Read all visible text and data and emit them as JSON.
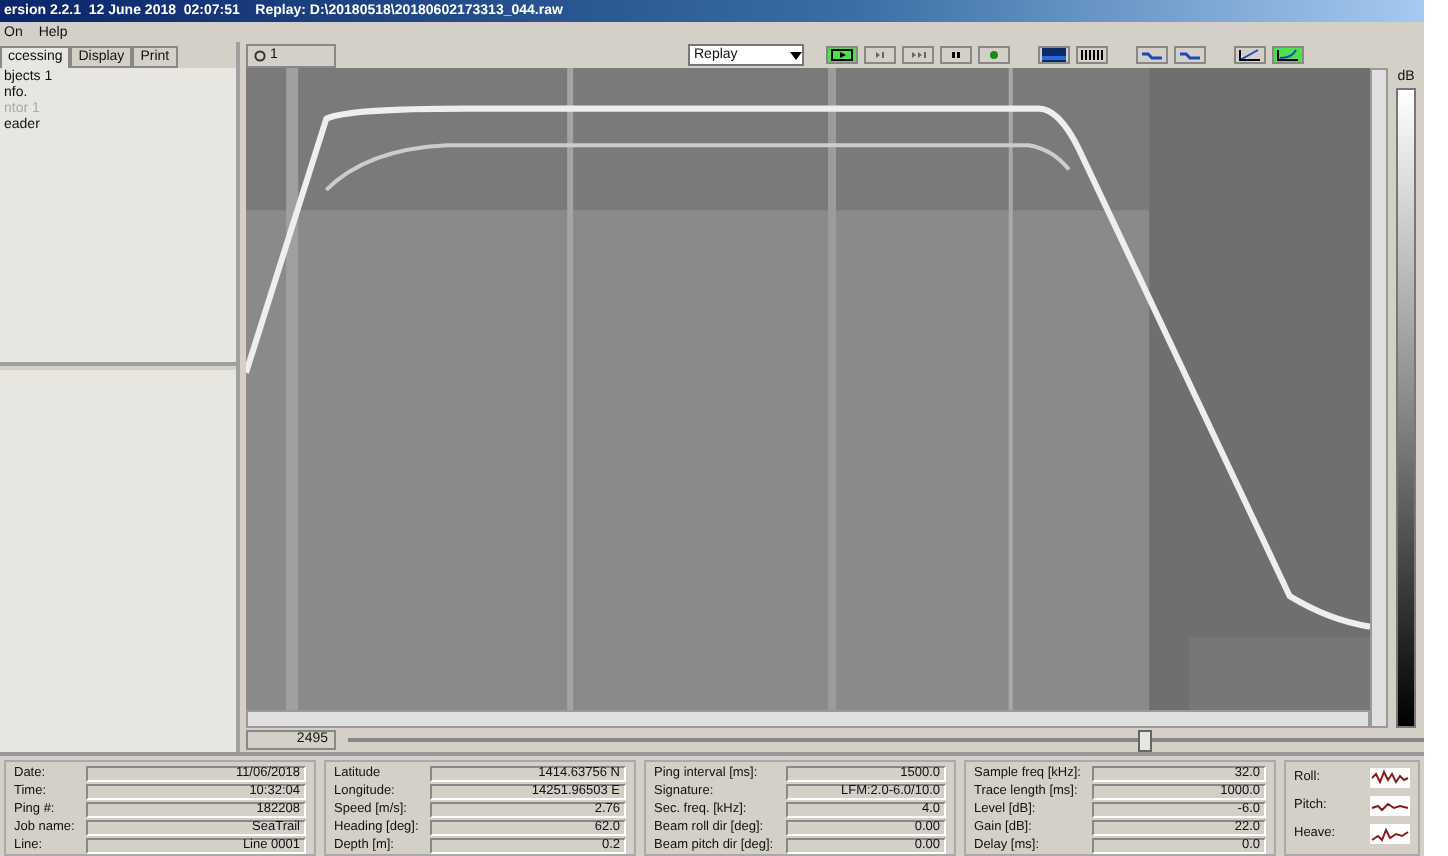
{
  "window": {
    "title": "ersion 2.2.1  12 June 2018  02:07:51    Replay: D:\\20180518\\20180602173313_044.raw"
  },
  "menu": [
    "On",
    "Help"
  ],
  "left_panel": {
    "tabs": [
      {
        "label": "ccessing",
        "selected": true
      },
      {
        "label": "Display",
        "selected": false
      },
      {
        "label": "Print",
        "selected": false
      }
    ],
    "items": [
      {
        "label": "bjects 1",
        "disabled": false
      },
      {
        "label": "nfo.",
        "disabled": false
      },
      {
        "label": "ntor 1",
        "disabled": true
      },
      {
        "label": "eader",
        "disabled": false
      }
    ]
  },
  "view_tab": {
    "label": "1"
  },
  "toolbar": {
    "mode": "Replay",
    "buttons": [
      {
        "kind": "play",
        "selected": true
      },
      {
        "kind": "step",
        "selected": false
      },
      {
        "kind": "forward",
        "selected": false
      },
      {
        "kind": "pause",
        "selected": false
      },
      {
        "kind": "record",
        "selected": false
      },
      {
        "kind": "colormap",
        "selected": false
      },
      {
        "kind": "bars",
        "selected": false
      },
      {
        "kind": "wave",
        "selected": false
      },
      {
        "kind": "wave",
        "selected": false
      },
      {
        "kind": "line",
        "selected": false
      },
      {
        "kind": "curve",
        "selected": true
      }
    ]
  },
  "scale": {
    "label": "dB"
  },
  "position": {
    "value": "2495",
    "level": 0.74
  },
  "info_groups": [
    [
      {
        "label": "Date:",
        "value": "11/06/2018"
      },
      {
        "label": "Time:",
        "value": "10:32:04"
      },
      {
        "label": "Ping #:",
        "value": "182208"
      },
      {
        "label": "Job name:",
        "value": "SeaTrail"
      },
      {
        "label": "Line:",
        "value": "Line 0001"
      }
    ],
    [
      {
        "label": "Latitude",
        "value": "1414.63756 N"
      },
      {
        "label": "Longitude:",
        "value": "14251.96503 E"
      },
      {
        "label": "Speed [m/s]:",
        "value": "2.76"
      },
      {
        "label": "Heading [deg]:",
        "value": "62.0"
      },
      {
        "label": "Depth [m]:",
        "value": "0.2"
      }
    ],
    [
      {
        "label": "Ping interval [ms]:",
        "value": "1500.0"
      },
      {
        "label": "Signature:",
        "value": "LFM:2.0-6.0/10.0"
      },
      {
        "label": "Sec. freq. [kHz]:",
        "value": "4.0"
      },
      {
        "label": "Beam roll dir [deg]:",
        "value": "0.00"
      },
      {
        "label": "Beam pitch dir [deg]:",
        "value": "0.00"
      }
    ],
    [
      {
        "label": "Sample freq [kHz]:",
        "value": "32.0"
      },
      {
        "label": "Trace length [ms]:",
        "value": "1000.0"
      },
      {
        "label": "Level [dB]:",
        "value": "-6.0"
      },
      {
        "label": "Gain [dB]:",
        "value": "22.0"
      },
      {
        "label": "Delay [ms]:",
        "value": "0.0"
      }
    ]
  ],
  "motion": [
    {
      "label": "Roll:"
    },
    {
      "label": "Pitch:"
    },
    {
      "label": "Heave:"
    }
  ]
}
